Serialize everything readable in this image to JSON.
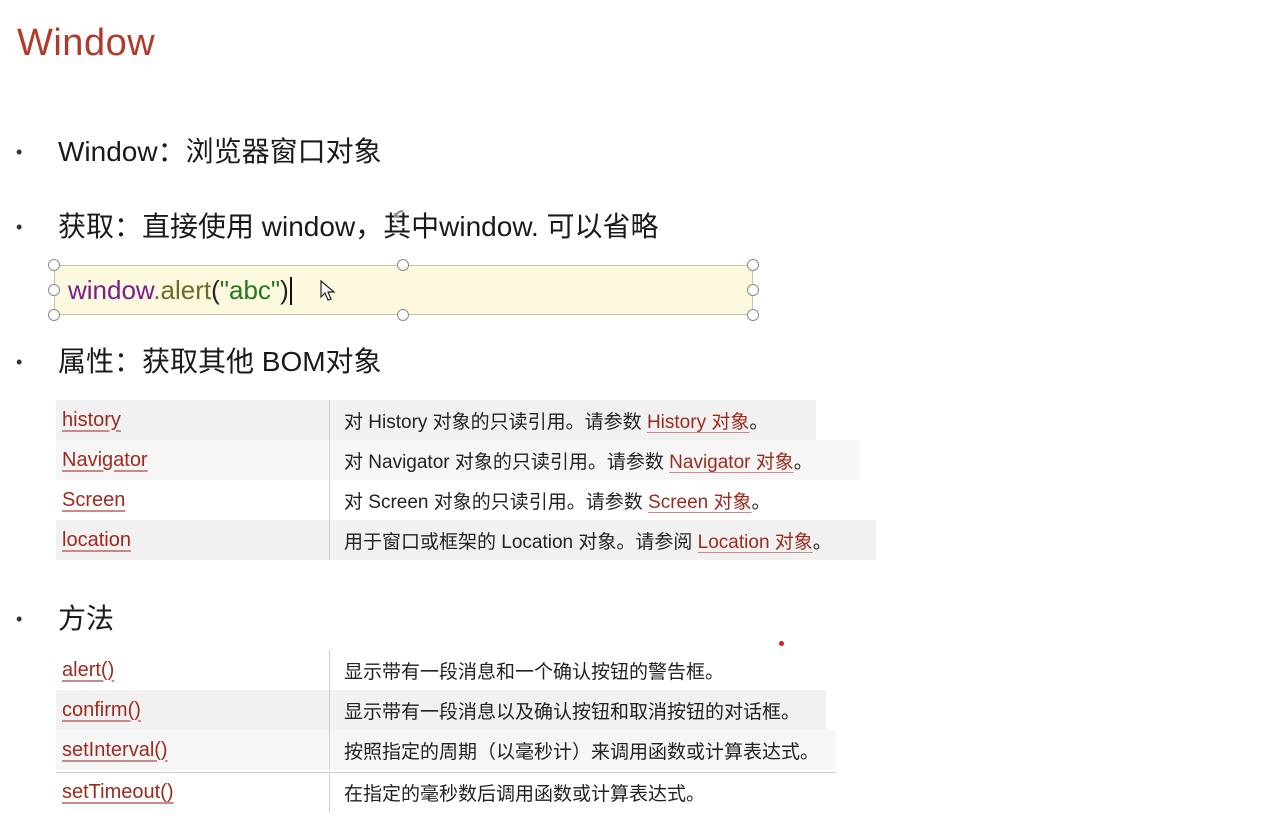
{
  "slide": {
    "title": "Window"
  },
  "bullets": {
    "b1": "Window：浏览器窗口对象",
    "b2": "获取：直接使用 window，其中window. 可以省略",
    "b3": "属性：获取其他 BOM对象",
    "b4": "方法",
    "dot": "•"
  },
  "code": {
    "obj": "window",
    "dot": ".",
    "fn": "alert",
    "open": "(",
    "str": "\"abc\"",
    "close": ")"
  },
  "properties": [
    {
      "name": "history",
      "desc_pre": "对 History 对象的只读引用。请参数 ",
      "link": "History 对象",
      "desc_post": "。"
    },
    {
      "name": "Navigator",
      "desc_pre": "对 Navigator 对象的只读引用。请参数 ",
      "link": "Navigator 对象",
      "desc_post": "。"
    },
    {
      "name": "Screen",
      "desc_pre": "对 Screen 对象的只读引用。请参数 ",
      "link": "Screen 对象",
      "desc_post": "。"
    },
    {
      "name": "location",
      "desc_pre": "用于窗口或框架的 Location 对象。请参阅 ",
      "link": "Location 对象",
      "desc_post": "。"
    }
  ],
  "methods": [
    {
      "name": "alert()",
      "desc": "显示带有一段消息和一个确认按钮的警告框。"
    },
    {
      "name": "confirm()",
      "desc": "显示带有一段消息以及确认按钮和取消按钮的对话框。"
    },
    {
      "name": "setInterval()",
      "desc": "按照指定的周期（以毫秒计）来调用函数或计算表达式。"
    },
    {
      "name": "setTimeout()",
      "desc": "在指定的毫秒数后调用函数或计算表达式。"
    }
  ],
  "colors": {
    "title": "#b23a2a",
    "link": "#9e2a1e",
    "code_bg": "#fdf9df",
    "pointer_dot": "#e21b1b"
  }
}
